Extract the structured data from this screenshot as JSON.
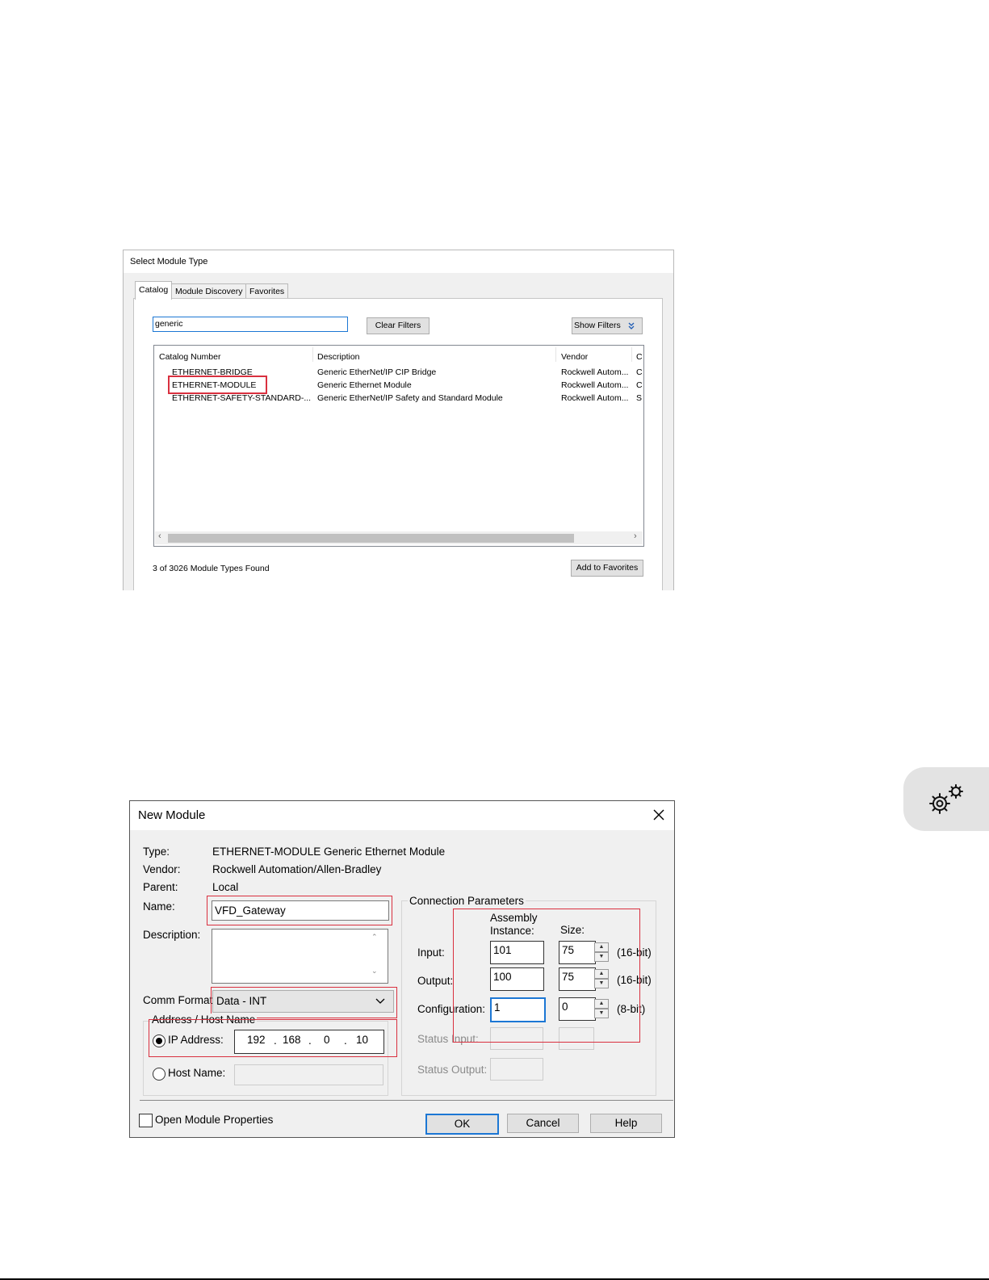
{
  "select_module_type": {
    "title": "Select Module Type",
    "tabs": [
      "Catalog",
      "Module Discovery",
      "Favorites"
    ],
    "search_value": "generic",
    "clear_filters_label": "Clear Filters",
    "show_filters_label": "Show Filters",
    "columns": [
      "Catalog Number",
      "Description",
      "Vendor",
      "C"
    ],
    "rows": [
      {
        "catalog": "ETHERNET-BRIDGE",
        "description": "Generic EtherNet/IP CIP Bridge",
        "vendor": "Rockwell Autom...",
        "cat": "C"
      },
      {
        "catalog": "ETHERNET-MODULE",
        "description": "Generic Ethernet Module",
        "vendor": "Rockwell Autom...",
        "cat": "C"
      },
      {
        "catalog": "ETHERNET-SAFETY-STANDARD-...",
        "description": "Generic EtherNet/IP Safety and Standard Module",
        "vendor": "Rockwell Autom...",
        "cat": "S"
      }
    ],
    "status": "3 of 3026 Module Types Found",
    "add_favorites_label": "Add to Favorites"
  },
  "new_module": {
    "title": "New Module",
    "labels": {
      "type": "Type:",
      "vendor": "Vendor:",
      "parent": "Parent:",
      "name": "Name:",
      "description": "Description:",
      "comm_format": "Comm Format:",
      "address_group": "Address / Host Name",
      "ip_address": "IP Address:",
      "host_name": "Host Name:",
      "connection_group": "Connection Parameters",
      "assembly_instance": "Assembly Instance:",
      "assembly_line1": "Assembly",
      "assembly_line2": "Instance:",
      "size": "Size:",
      "input": "Input:",
      "output": "Output:",
      "configuration": "Configuration:",
      "status_input": "Status Input:",
      "status_output": "Status Output:",
      "open_props": "Open Module Properties"
    },
    "values": {
      "type": "ETHERNET-MODULE Generic Ethernet Module",
      "vendor": "Rockwell Automation/Allen-Bradley",
      "parent": "Local",
      "name": "VFD_Gateway",
      "comm_format": "Data - INT",
      "ip1": "192",
      "ip2": "168",
      "ip3": "0",
      "ip4": "10",
      "input_instance": "101",
      "input_size": "75",
      "input_unit": "(16-bit)",
      "output_instance": "100",
      "output_size": "75",
      "output_unit": "(16-bit)",
      "config_instance": "1",
      "config_size": "0",
      "config_unit": "(8-bit)"
    },
    "buttons": {
      "ok": "OK",
      "cancel": "Cancel",
      "help": "Help"
    }
  },
  "icons": [
    "close-icon",
    "gears-icon",
    "chevron-down-icon",
    "double-chevron-down-icon",
    "scroll-left-icon",
    "scroll-right-icon",
    "scroll-up-icon",
    "scroll-down-icon"
  ]
}
